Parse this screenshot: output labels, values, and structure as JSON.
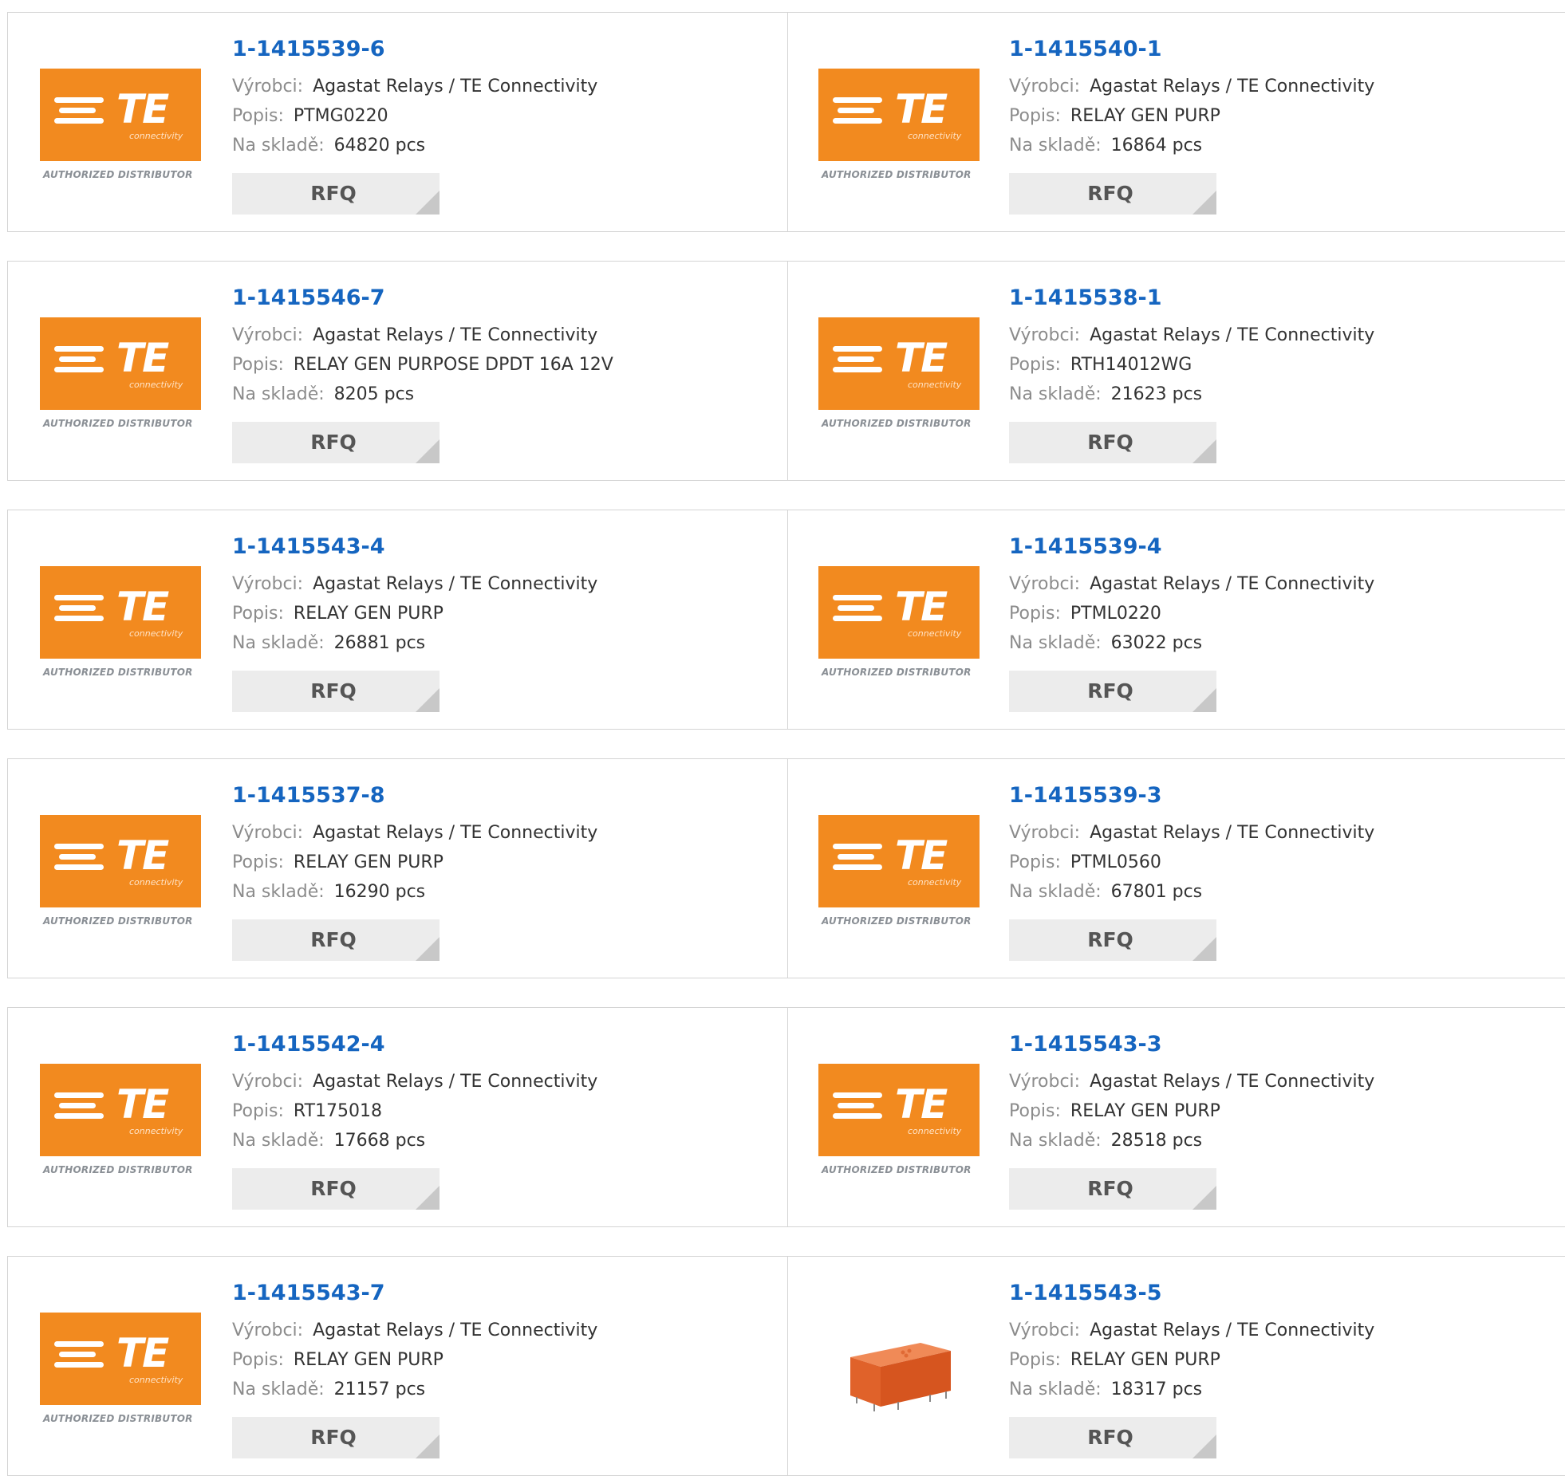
{
  "labels": {
    "manufacturer": "Výrobci:",
    "description": "Popis:",
    "stock": "Na skladě:"
  },
  "rfq_label": "RFQ",
  "logo": {
    "brand_text": "TE",
    "sub_text": "connectivity",
    "authorized_text": "AUTHORIZED DISTRIBUTOR",
    "brand_color": "#f28a1f"
  },
  "products": [
    {
      "part": "1-1415539-6",
      "manufacturer": "Agastat Relays / TE Connectivity",
      "description": "PTMG0220",
      "stock": "64820 pcs",
      "image": "te-logo"
    },
    {
      "part": "1-1415540-1",
      "manufacturer": "Agastat Relays / TE Connectivity",
      "description": "RELAY GEN PURP",
      "stock": "16864 pcs",
      "image": "te-logo"
    },
    {
      "part": "1-1415546-7",
      "manufacturer": "Agastat Relays / TE Connectivity",
      "description": "RELAY GEN PURPOSE DPDT 16A 12V",
      "stock": "8205 pcs",
      "image": "te-logo"
    },
    {
      "part": "1-1415538-1",
      "manufacturer": "Agastat Relays / TE Connectivity",
      "description": "RTH14012WG",
      "stock": "21623 pcs",
      "image": "te-logo"
    },
    {
      "part": "1-1415543-4",
      "manufacturer": "Agastat Relays / TE Connectivity",
      "description": "RELAY GEN PURP",
      "stock": "26881 pcs",
      "image": "te-logo"
    },
    {
      "part": "1-1415539-4",
      "manufacturer": "Agastat Relays / TE Connectivity",
      "description": "PTML0220",
      "stock": "63022 pcs",
      "image": "te-logo"
    },
    {
      "part": "1-1415537-8",
      "manufacturer": "Agastat Relays / TE Connectivity",
      "description": "RELAY GEN PURP",
      "stock": "16290 pcs",
      "image": "te-logo"
    },
    {
      "part": "1-1415539-3",
      "manufacturer": "Agastat Relays / TE Connectivity",
      "description": "PTML0560",
      "stock": "67801 pcs",
      "image": "te-logo"
    },
    {
      "part": "1-1415542-4",
      "manufacturer": "Agastat Relays / TE Connectivity",
      "description": "RT175018",
      "stock": "17668 pcs",
      "image": "te-logo"
    },
    {
      "part": "1-1415543-3",
      "manufacturer": "Agastat Relays / TE Connectivity",
      "description": "RELAY GEN PURP",
      "stock": "28518 pcs",
      "image": "te-logo"
    },
    {
      "part": "1-1415543-7",
      "manufacturer": "Agastat Relays / TE Connectivity",
      "description": "RELAY GEN PURP",
      "stock": "21157 pcs",
      "image": "te-logo"
    },
    {
      "part": "1-1415543-5",
      "manufacturer": "Agastat Relays / TE Connectivity",
      "description": "RELAY GEN PURP",
      "stock": "18317 pcs",
      "image": "relay-photo"
    }
  ]
}
